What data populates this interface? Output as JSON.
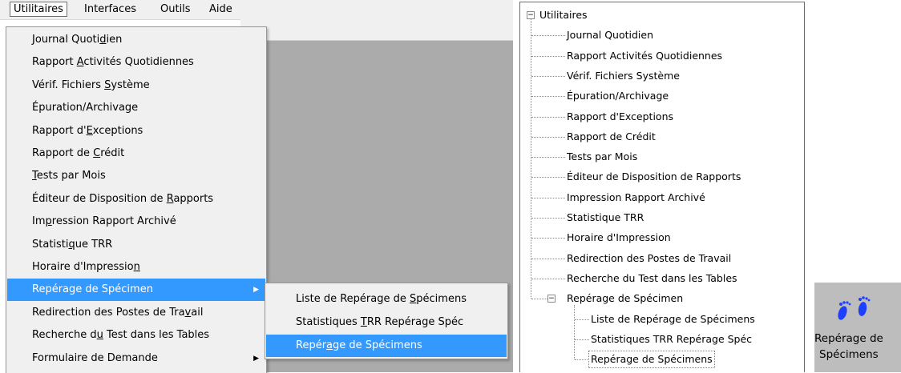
{
  "menubar": {
    "items": [
      "Utilitaires",
      "Interfaces",
      "Outils",
      "Aide"
    ],
    "active_index": 0
  },
  "main_menu": {
    "items": [
      {
        "pre": "Journal Quoti",
        "u": "d",
        "post": "ien",
        "submenu": false
      },
      {
        "pre": "Rapport ",
        "u": "A",
        "post": "ctivités Quotidiennes",
        "submenu": false
      },
      {
        "pre": "Vérif. Fichiers ",
        "u": "S",
        "post": "ystème",
        "submenu": false
      },
      {
        "pre": "Épuration/Archivage",
        "u": "",
        "post": "",
        "submenu": false
      },
      {
        "pre": "Rapport d'",
        "u": "E",
        "post": "xceptions",
        "submenu": false
      },
      {
        "pre": "Rapport de ",
        "u": "C",
        "post": "rédit",
        "submenu": false
      },
      {
        "pre": "",
        "u": "T",
        "post": "ests par Mois",
        "submenu": false
      },
      {
        "pre": "Éditeur de Disposition de ",
        "u": "R",
        "post": "apports",
        "submenu": false
      },
      {
        "pre": "Im",
        "u": "p",
        "post": "ression Rapport Archivé",
        "submenu": false
      },
      {
        "pre": "Statisti",
        "u": "q",
        "post": "ue TRR",
        "submenu": false
      },
      {
        "pre": "Horaire d'Impressio",
        "u": "n",
        "post": "",
        "submenu": false
      },
      {
        "pre": "Repérage de Spécimen",
        "u": "",
        "post": "",
        "submenu": true,
        "highlighted": true
      },
      {
        "pre": "Redirection des Postes de Tra",
        "u": "v",
        "post": "ail",
        "submenu": false
      },
      {
        "pre": "Recherche d",
        "u": "u",
        "post": " Test dans les Tables",
        "submenu": false
      },
      {
        "pre": "Formulaire de Demande",
        "u": "",
        "post": "",
        "submenu": true
      }
    ]
  },
  "submenu": {
    "items": [
      {
        "pre": "Liste de Repérage de ",
        "u": "S",
        "post": "pécimens"
      },
      {
        "pre": "Statistiques ",
        "u": "T",
        "post": "RR Repérage Spéc"
      },
      {
        "pre": "Repér",
        "u": "a",
        "post": "ge de Spécimens",
        "highlighted": true
      }
    ]
  },
  "tree": {
    "root": {
      "label": "Utilitaires",
      "expanded": true,
      "toggle": "−"
    },
    "children": [
      "Journal Quotidien",
      "Rapport Activités Quotidiennes",
      "Vérif. Fichiers Système",
      "Épuration/Archivage",
      "Rapport d'Exceptions",
      "Rapport de Crédit",
      "Tests par Mois",
      "Éditeur de Disposition de Rapports",
      "Impression Rapport Archivé",
      "Statistique TRR",
      "Horaire d'Impression",
      "Redirection des Postes de Travail",
      "Recherche du Test dans les Tables"
    ],
    "expanded_child": {
      "label": "Repérage de Spécimen",
      "toggle": "−",
      "children": [
        "Liste de Repérage de Spécimens",
        "Statistiques TRR Repérage Spéc",
        "Repérage de Spécimens"
      ]
    }
  },
  "toolbar_button": {
    "icon": "footprints-icon",
    "label_line1": "Repérage de",
    "label_line2": "Spécimens",
    "icon_color": "#1f3fff"
  },
  "colors": {
    "highlight": "#3399ff",
    "menu_bg": "#f0f0f0",
    "workspace": "#ababab",
    "button_bg": "#bdbdbd"
  }
}
